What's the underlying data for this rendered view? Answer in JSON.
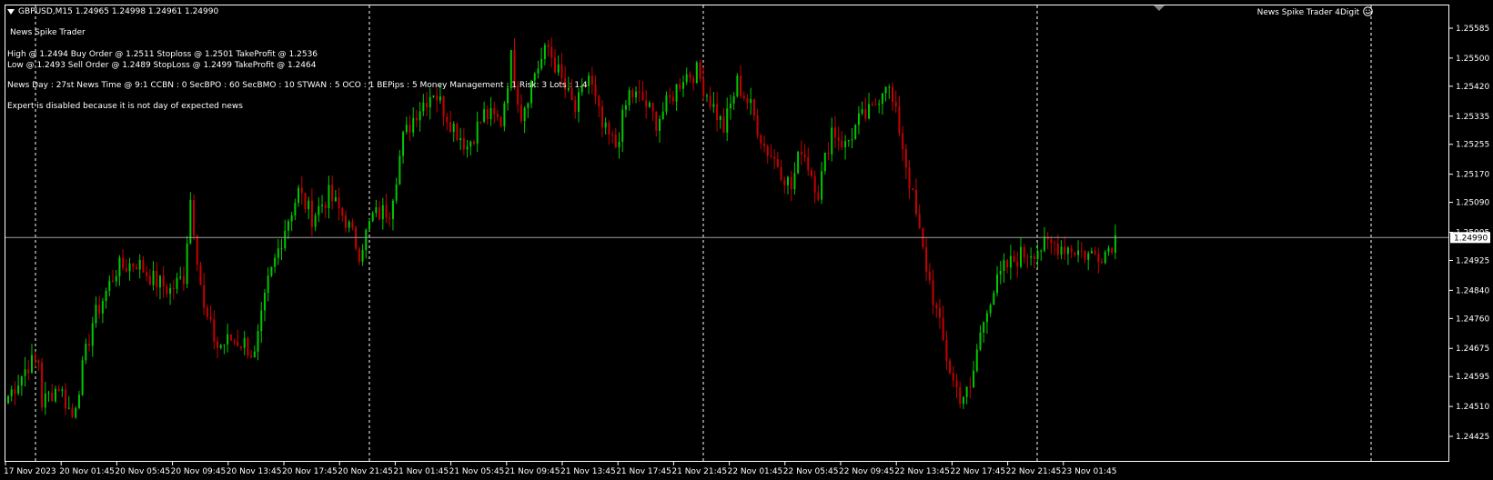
{
  "colors": {
    "background": "#000000",
    "bull": "#00c800",
    "bear": "#c80000",
    "grid": "#ffffff",
    "text": "#ffffff",
    "price_line": "#a0a0a0",
    "price_box_bg": "#ffffff",
    "price_box_text": "#000000"
  },
  "header": {
    "symbol_line": "GBPUSD,M15  1.24965 1.24998 1.24961 1.24990",
    "expert_name": "News Spike Trader 4Digit",
    "expert_icon": "smiley-icon",
    "dropdown_icon": "triangle-down-icon"
  },
  "info": {
    "title": "News Spike Trader",
    "high_line": "High @ 1.2494 Buy Order @ 1.2511 Stoploss @ 1.2501 TakeProfit @ 1.2536",
    "low_line": "Low @ 1.2493 Sell Order @ 1.2489 StopLoss @ 1.2499 TakeProfit @ 1.2464",
    "settings_line": "News Day : 27st News Time @ 9:1 CCBN : 0 SecBPO : 60 SecBMO : 10 STWAN : 5 OCO : 1 BEPips : 5 Money Management : 1 Risk: 3 Lots : 1.4",
    "status_line": "Expert is disabled because it is not day of expected news"
  },
  "chart_data": {
    "type": "candlestick",
    "symbol": "GBPUSD",
    "timeframe": "M15",
    "current_price": "1.24990",
    "ylim": [
      1.24425,
      1.25585
    ],
    "y_ticks": [
      "1.25585",
      "1.25500",
      "1.25420",
      "1.25335",
      "1.25255",
      "1.25170",
      "1.25090",
      "1.25005",
      "1.24925",
      "1.24840",
      "1.24760",
      "1.24675",
      "1.24595",
      "1.24510",
      "1.24425"
    ],
    "x_ticks": [
      "17 Nov 2023",
      "20 Nov 01:45",
      "20 Nov 05:45",
      "20 Nov 09:45",
      "20 Nov 13:45",
      "20 Nov 17:45",
      "20 Nov 21:45",
      "21 Nov 01:45",
      "21 Nov 05:45",
      "21 Nov 09:45",
      "21 Nov 13:45",
      "21 Nov 17:45",
      "21 Nov 21:45",
      "22 Nov 01:45",
      "22 Nov 05:45",
      "22 Nov 09:45",
      "22 Nov 13:45",
      "22 Nov 17:45",
      "22 Nov 21:45",
      "23 Nov 01:45"
    ],
    "period_separators": [
      "20 Nov 2023",
      "21 Nov 2023",
      "22 Nov 2023",
      "23 Nov 2023"
    ],
    "grid": false,
    "close_anchors": [
      [
        0,
        1.2454
      ],
      [
        6,
        1.2463
      ],
      [
        9,
        1.2464
      ],
      [
        10,
        1.2452
      ],
      [
        15,
        1.2457
      ],
      [
        19,
        1.2448
      ],
      [
        25,
        1.2475
      ],
      [
        32,
        1.249
      ],
      [
        38,
        1.2492
      ],
      [
        43,
        1.2487
      ],
      [
        48,
        1.2484
      ],
      [
        52,
        1.2488
      ],
      [
        54,
        1.251
      ],
      [
        58,
        1.2478
      ],
      [
        62,
        1.2468
      ],
      [
        66,
        1.247
      ],
      [
        70,
        1.2469
      ],
      [
        73,
        1.2465
      ],
      [
        77,
        1.2486
      ],
      [
        82,
        1.2502
      ],
      [
        86,
        1.2512
      ],
      [
        90,
        1.2505
      ],
      [
        95,
        1.2511
      ],
      [
        100,
        1.2504
      ],
      [
        104,
        1.2495
      ],
      [
        108,
        1.2505
      ],
      [
        113,
        1.2507
      ],
      [
        117,
        1.2527
      ],
      [
        121,
        1.2535
      ],
      [
        126,
        1.2541
      ],
      [
        131,
        1.2532
      ],
      [
        136,
        1.2525
      ],
      [
        141,
        1.2534
      ],
      [
        146,
        1.2532
      ],
      [
        149,
        1.255
      ],
      [
        152,
        1.2534
      ],
      [
        156,
        1.2546
      ],
      [
        160,
        1.2553
      ],
      [
        165,
        1.2541
      ],
      [
        168,
        1.2535
      ],
      [
        172,
        1.2545
      ],
      [
        176,
        1.253
      ],
      [
        180,
        1.2525
      ],
      [
        184,
        1.254
      ],
      [
        188,
        1.2538
      ],
      [
        192,
        1.2532
      ],
      [
        196,
        1.2538
      ],
      [
        200,
        1.2545
      ],
      [
        204,
        1.2546
      ],
      [
        208,
        1.2538
      ],
      [
        212,
        1.253
      ],
      [
        216,
        1.2543
      ],
      [
        220,
        1.2536
      ],
      [
        224,
        1.2525
      ],
      [
        228,
        1.252
      ],
      [
        232,
        1.2513
      ],
      [
        235,
        1.2525
      ],
      [
        240,
        1.2512
      ],
      [
        244,
        1.253
      ],
      [
        248,
        1.2525
      ],
      [
        252,
        1.2532
      ],
      [
        256,
        1.2535
      ],
      [
        260,
        1.2544
      ],
      [
        264,
        1.253
      ],
      [
        267,
        1.2515
      ],
      [
        271,
        1.2495
      ],
      [
        274,
        1.2482
      ],
      [
        278,
        1.2465
      ],
      [
        280,
        1.2458
      ],
      [
        282,
        1.2454
      ],
      [
        285,
        1.2455
      ],
      [
        287,
        1.2467
      ],
      [
        290,
        1.248
      ],
      [
        295,
        1.249
      ],
      [
        300,
        1.2494
      ],
      [
        305,
        1.2496
      ],
      [
        310,
        1.2497
      ],
      [
        315,
        1.2496
      ],
      [
        320,
        1.2494
      ],
      [
        325,
        1.2495
      ],
      [
        328,
        1.2499
      ]
    ]
  }
}
